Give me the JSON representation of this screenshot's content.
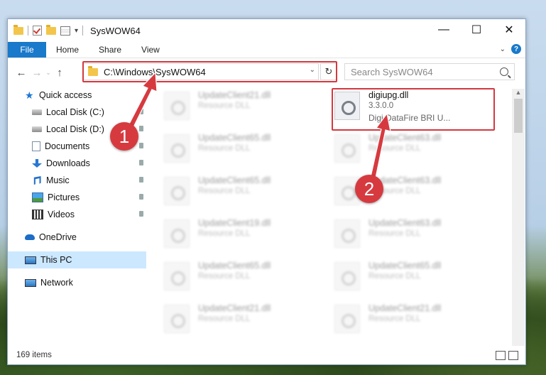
{
  "window": {
    "title": "SysWOW64",
    "controls": [
      "—",
      "☐",
      "✕"
    ]
  },
  "ribbon": {
    "tabs": [
      "File",
      "Home",
      "Share",
      "View"
    ],
    "help": "?"
  },
  "address": {
    "path": "C:\\Windows\\SysWOW64",
    "search_placeholder": "Search SysWOW64"
  },
  "sidebar": {
    "quick_access": "Quick access",
    "items": [
      "Local Disk (C:)",
      "Local Disk (D:)",
      "Documents",
      "Downloads",
      "Music",
      "Pictures",
      "Videos"
    ],
    "onedrive": "OneDrive",
    "this_pc": "This PC",
    "network": "Network"
  },
  "files": {
    "highlighted": {
      "name": "digiupg.dll",
      "version": "3.3.0.0",
      "description": "Digi DataFire BRI U..."
    },
    "blurred_left": [
      {
        "name": "UpdateClient21.dll",
        "type": "Resource DLL"
      },
      {
        "name": "UpdateClient65.dll",
        "type": "Resource DLL"
      },
      {
        "name": "UpdateClient65.dll",
        "type": "Resource DLL"
      },
      {
        "name": "UpdateClient19.dll",
        "type": "Resource DLL"
      },
      {
        "name": "UpdateClient65.dll",
        "type": "Resource DLL"
      },
      {
        "name": "UpdateClient21.dll",
        "type": "Resource DLL"
      }
    ],
    "blurred_right": [
      {
        "name": "UpdateClient63.dll",
        "type": "Resource DLL"
      },
      {
        "name": "UpdateClient63.dll",
        "type": "Resource DLL"
      },
      {
        "name": "UpdateClient63.dll",
        "type": "Resource DLL"
      },
      {
        "name": "UpdateClient65.dll",
        "type": "Resource DLL"
      },
      {
        "name": "UpdateClient21.dll",
        "type": "Resource DLL"
      }
    ]
  },
  "status": {
    "count": "169 items"
  },
  "annotations": {
    "badge1": "1",
    "badge2": "2",
    "color": "#d63a3f"
  }
}
